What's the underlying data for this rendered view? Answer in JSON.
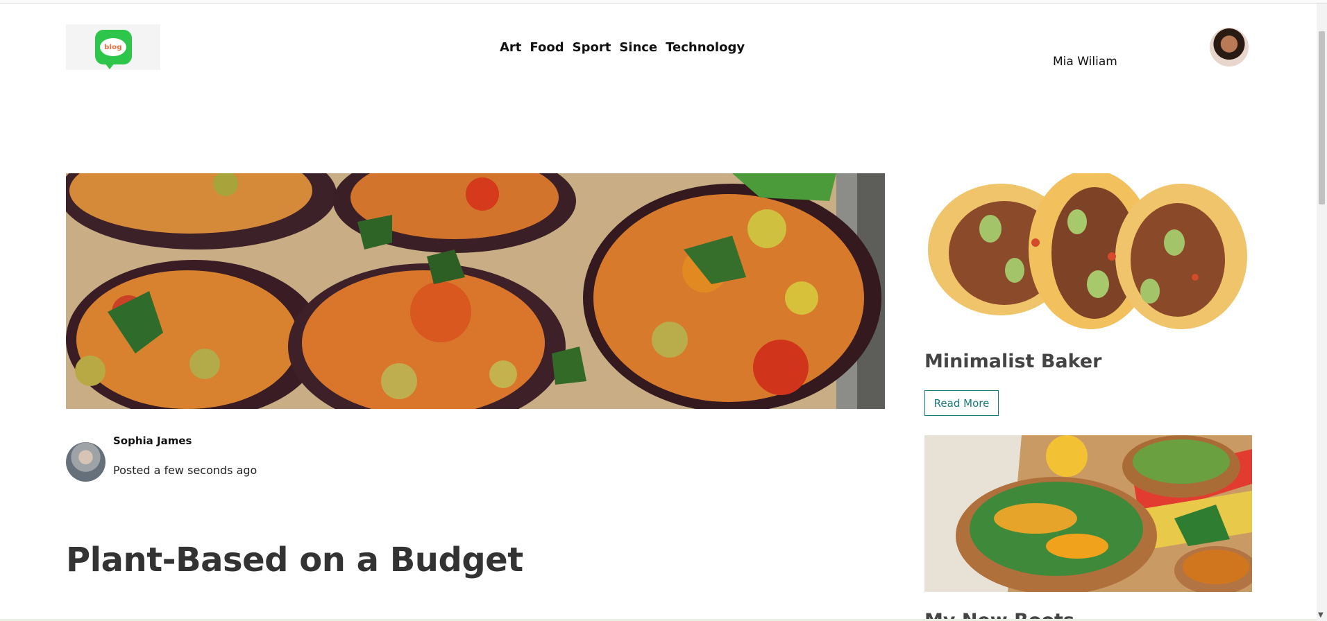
{
  "header": {
    "logo_text": "blog",
    "nav": [
      "Art",
      "Food",
      "Sport",
      "Since",
      "Technology"
    ],
    "user_name": "Mia Wiliam"
  },
  "main_post": {
    "author": "Sophia James",
    "posted": "Posted a few seconds ago",
    "title": "Plant-Based on a Budget"
  },
  "sidebar": {
    "cards": [
      {
        "title": "Minimalist Baker",
        "button": "Read More"
      },
      {
        "title": "My New Roots"
      }
    ]
  },
  "colors": {
    "logo_green": "#2ec64a",
    "logo_text": "#ef6b39",
    "button_accent": "#177a7a"
  }
}
